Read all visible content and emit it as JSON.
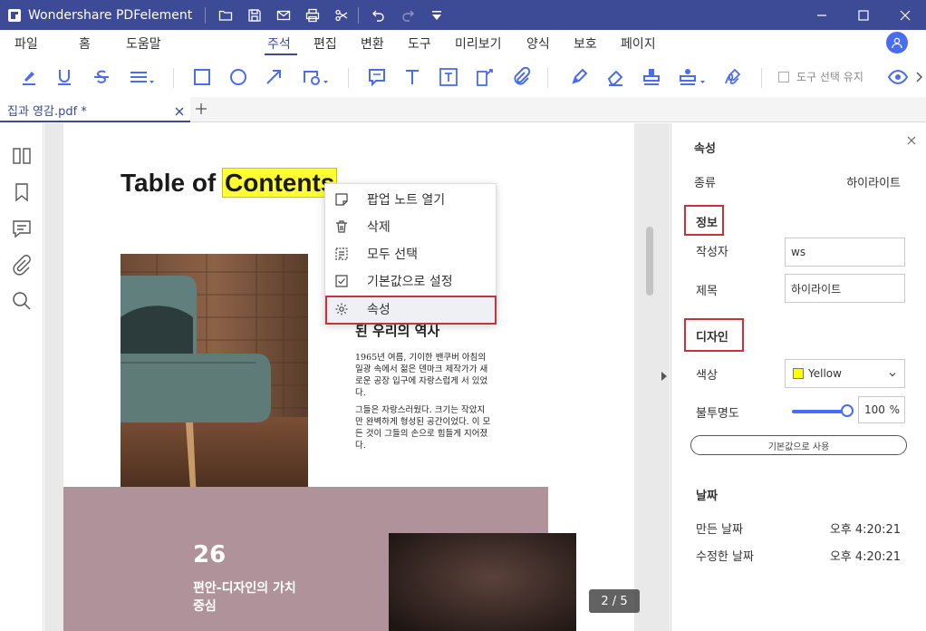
{
  "app": {
    "name": "Wondershare PDFelement",
    "accent_color": "#3d4a95",
    "highlight_color": "#ffff33"
  },
  "quick_access": [
    "open-folder-icon",
    "save-icon",
    "mail-icon",
    "print-icon",
    "cut-icon",
    "undo-icon",
    "redo-icon",
    "more-down-icon"
  ],
  "menu": {
    "items": [
      "파일",
      "홈",
      "도움말",
      "주석",
      "편집",
      "변환",
      "도구",
      "미리보기",
      "양식",
      "보호",
      "페이지"
    ],
    "active": "주석"
  },
  "toolbar": {
    "tools": [
      "highlight-icon",
      "underline-icon",
      "strikethrough-icon",
      "lines-icon",
      "rectangle-icon",
      "circle-icon",
      "arrow-icon",
      "shape-icon",
      "note-icon",
      "text-icon",
      "textbox-icon",
      "callout-icon",
      "attachment-icon",
      "pencil-icon",
      "eraser-icon",
      "stamp-icon",
      "stamp-menu-icon",
      "signature-icon"
    ],
    "keep_tool_label": "도구 선택 유지"
  },
  "tabs": {
    "document_tab": "집과 영감.pdf *"
  },
  "document": {
    "heading_pre": "Table of ",
    "heading_highlight": "Contents",
    "section_title": "된 우리의 역사",
    "para1": "1965년 여름, 기이한 밴쿠버 아침의 일광 속에서 젊은 덴마크 제작가가 새로운 공장 입구에 자랑스럽게 서 있었다.",
    "para2": "그들은 자랑스러웠다. 크기는 작았지만 완벽하게 형성된 공간이었다. 이 모든 것이 그들의 손으로 힘들게 지어졌다.",
    "stat_number": "26",
    "stat_text": "편안-디자인의 가치 중심",
    "page_indicator": "2 / 5"
  },
  "context_menu": {
    "items": [
      "팝업 노트 열기",
      "삭제",
      "모두 선택",
      "기본값으로 설정",
      "속성"
    ],
    "selected": "속성"
  },
  "properties": {
    "title": "속성",
    "type_label": "종류",
    "type_value": "하이라이트",
    "info_group": "정보",
    "author_label": "작성자",
    "author_value": "ws",
    "subject_label": "제목",
    "subject_value": "하이라이트",
    "design_group": "디자인",
    "color_label": "색상",
    "color_value": "Yellow",
    "color_hex": "#ffff00",
    "opacity_label": "불투명도",
    "opacity_value": "100",
    "opacity_unit": "%",
    "opacity_fraction": 1.0,
    "default_button": "기본값으로 사용",
    "date_group": "날짜",
    "created_label": "만든 날짜",
    "created_value": "오후 4:20:21",
    "modified_label": "수정한 날짜",
    "modified_value": "오후 4:20:21"
  }
}
